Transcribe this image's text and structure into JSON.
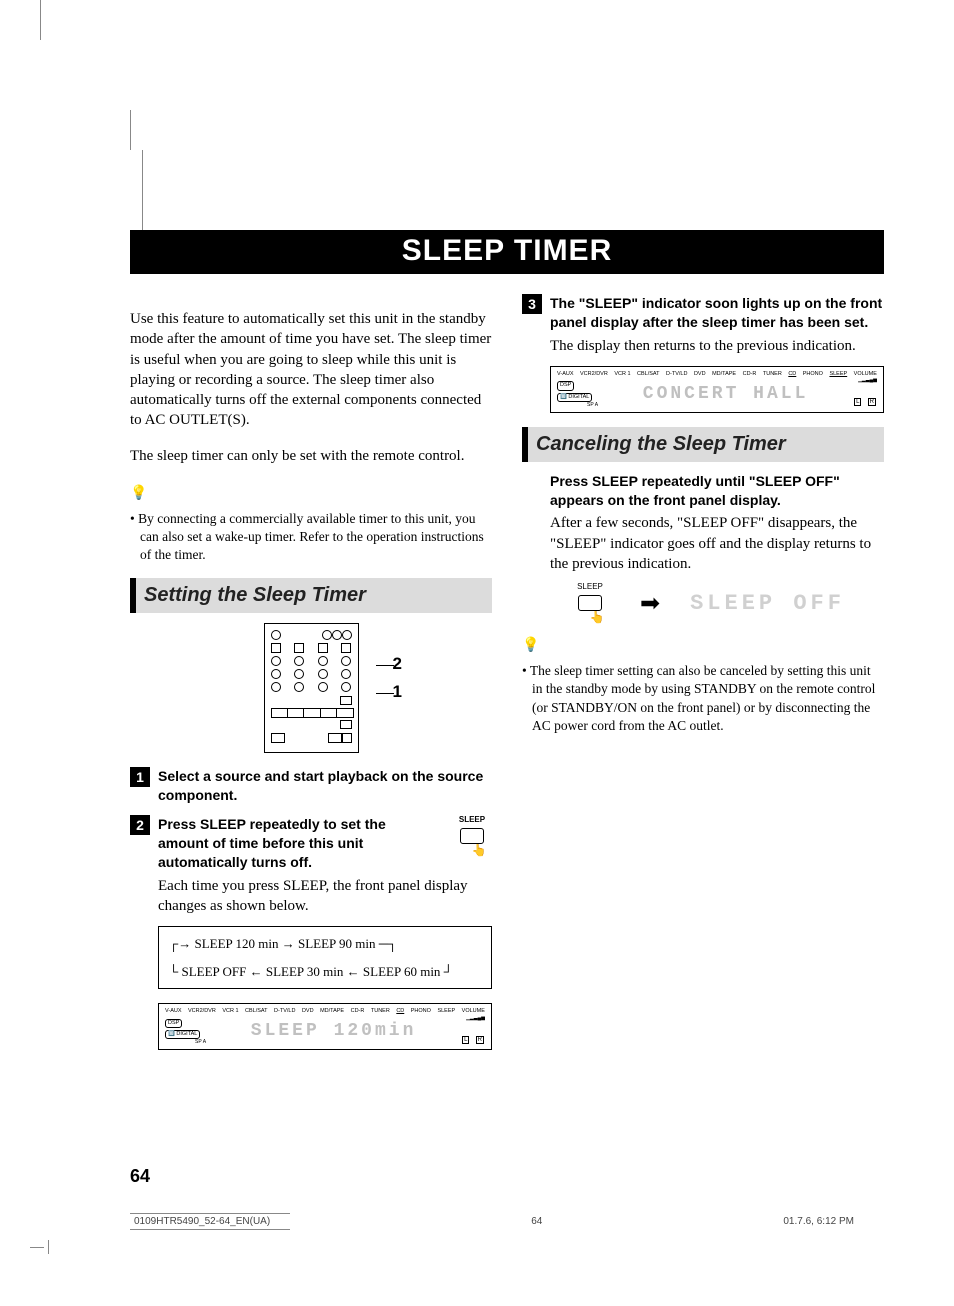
{
  "title": "SLEEP TIMER",
  "intro": {
    "p1": "Use this feature to automatically set this unit in the standby mode after the amount of time you have set. The sleep timer is useful when you are going to sleep while this unit is playing or recording a source. The sleep timer also automatically turns off the external components connected to AC OUTLET(S).",
    "p2": "The sleep timer can only be set with the remote control.",
    "tip1": "By connecting a commercially available timer to this unit, you can also set a wake-up timer. Refer to the operation instructions of the timer."
  },
  "setting": {
    "heading": "Setting the Sleep Timer",
    "callouts": {
      "one": "1",
      "two": "2"
    },
    "step1": {
      "num": "1",
      "bold": "Select a source and start playback on the source component."
    },
    "step2": {
      "num": "2",
      "bold": "Press SLEEP repeatedly to set the amount of time before this unit automatically turns off.",
      "cont": "Each time you press SLEEP, the front panel display changes as shown below.",
      "sleep_label": "SLEEP"
    },
    "cycle": {
      "r1_a": "SLEEP 120 min",
      "r1_b": "SLEEP 90 min",
      "r2_a": "SLEEP OFF",
      "r2_b": "SLEEP 30 min",
      "r2_c": "SLEEP 60 min"
    },
    "display1": {
      "sources": [
        "V-AUX",
        "VCR2/DVR",
        "VCR 1",
        "CBL/SAT",
        "D-TV/LD",
        "DVD",
        "MD/TAPE",
        "CD-R",
        "TUNER",
        "CD",
        "PHONO",
        "SLEEP",
        "VOLUME"
      ],
      "flag1": "DSP",
      "flag2": "🔟 DIGITAL",
      "sp": "SP A",
      "lcd": "SLEEP  120min",
      "lr_l": "L",
      "lr_r": "R"
    }
  },
  "step3": {
    "num": "3",
    "bold": "The \"SLEEP\" indicator soon lights up on the front panel display after the sleep timer has been set.",
    "cont": "The display then returns to the previous indication.",
    "display2": {
      "sources": [
        "V-AUX",
        "VCR2/DVR",
        "VCR 1",
        "CBL/SAT",
        "D-TV/LD",
        "DVD",
        "MD/TAPE",
        "CD-R",
        "TUNER",
        "CD",
        "PHONO",
        "SLEEP",
        "VOLUME"
      ],
      "flag1": "DSP",
      "flag2": "🔟 DIGITAL",
      "sp": "SP A",
      "lcd": "CONCERT HALL",
      "lr_l": "L",
      "lr_r": "R"
    }
  },
  "cancel": {
    "heading": "Canceling the Sleep Timer",
    "bold": "Press SLEEP repeatedly until \"SLEEP OFF\" appears on the front panel display.",
    "cont": "After a few seconds, \"SLEEP OFF\" disappears, the \"SLEEP\" indicator goes off and the display returns to the previous indication.",
    "sleep_label": "SLEEP",
    "lcd_off": "SLEEP OFF",
    "tip": "The sleep timer setting can also be canceled by setting this unit in the standby mode by using STANDBY on the remote control (or STANDBY/ON on the front panel) or by disconnecting the AC power cord from the AC outlet."
  },
  "footer": {
    "page": "64",
    "file": "0109HTR5490_52-64_EN(UA)",
    "mid": "64",
    "date": "01.7.6, 6:12 PM"
  }
}
